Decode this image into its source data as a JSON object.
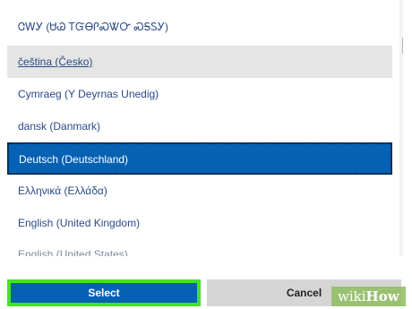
{
  "languages": [
    {
      "label": "ᏣᎳᎩ (ᏌᏊ ᎢᏳᎾᎵᏍᏔᏅ ᏍᎦᏚᎩ)",
      "state": "normal"
    },
    {
      "label": "čeština (Česko)",
      "state": "hover"
    },
    {
      "label": "Cymraeg (Y Deyrnas Unedig)",
      "state": "normal"
    },
    {
      "label": "dansk (Danmark)",
      "state": "normal"
    },
    {
      "label": "Deutsch (Deutschland)",
      "state": "selected"
    },
    {
      "label": "Ελληνικά (Ελλάδα)",
      "state": "normal"
    },
    {
      "label": "English (United Kingdom)",
      "state": "normal"
    },
    {
      "label": "English (United States)",
      "state": "partial"
    }
  ],
  "scrollbar": {
    "up_arrow_icon": "triangle-up-icon",
    "down_arrow_icon": "triangle-down-icon",
    "up_glyph": "▲",
    "down_glyph": "▼"
  },
  "buttons": {
    "select_label": "Select",
    "cancel_label": "Cancel"
  },
  "watermark": {
    "wiki": "wiki",
    "how": "How"
  },
  "colors": {
    "accent": "#0461b4",
    "highlight_border": "#46e226",
    "hover_bg": "#e5e5e5",
    "link_text": "#2a4a86"
  }
}
